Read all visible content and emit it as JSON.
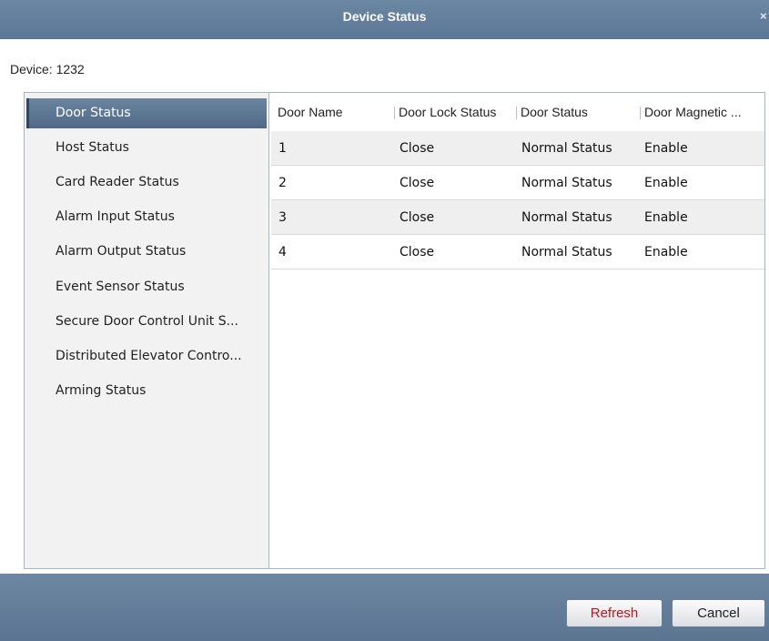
{
  "window": {
    "title": "Device Status",
    "close_glyph": "×"
  },
  "device": {
    "label": "Device: 1232"
  },
  "sidebar": {
    "items": [
      {
        "label": "Door Status",
        "active": true
      },
      {
        "label": "Host Status"
      },
      {
        "label": "Card Reader Status"
      },
      {
        "label": "Alarm Input Status"
      },
      {
        "label": "Alarm Output Status"
      },
      {
        "label": "Event Sensor Status"
      },
      {
        "label": "Secure Door Control Unit S..."
      },
      {
        "label": "Distributed Elevator Contro..."
      },
      {
        "label": "Arming Status"
      }
    ]
  },
  "table": {
    "columns": [
      "Door Name",
      "Door Lock Status",
      "Door Status",
      "Door Magnetic ..."
    ],
    "rows": [
      [
        "1",
        "Close",
        "Normal Status",
        "Enable"
      ],
      [
        "2",
        "Close",
        "Normal Status",
        "Enable"
      ],
      [
        "3",
        "Close",
        "Normal Status",
        "Enable"
      ],
      [
        "4",
        "Close",
        "Normal Status",
        "Enable"
      ]
    ]
  },
  "buttons": {
    "refresh_label": "Refresh",
    "cancel_label": "Cancel"
  },
  "colors": {
    "title_bar": "#5b7796",
    "selected_item": "#4f6a88",
    "refresh_text": "#c0151a"
  }
}
